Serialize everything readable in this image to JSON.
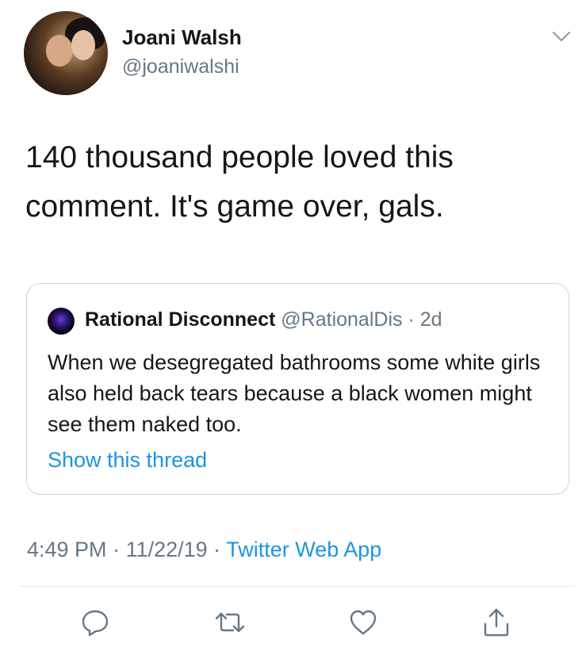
{
  "author": {
    "display_name": "Joani Walsh",
    "handle": "@joaniwalshi"
  },
  "tweet": {
    "text": "140 thousand people loved this comment. It's game over, gals."
  },
  "quoted_tweet": {
    "display_name": "Rational Disconnect",
    "handle": "@RationalDis",
    "age": "· 2d",
    "text": "When we desegregated bathrooms some white girls also held back tears because a black women might see them naked too.",
    "show_thread_label": "Show this thread"
  },
  "meta": {
    "time": "4:49 PM",
    "separator": " · ",
    "date": "11/22/19",
    "app": "Twitter Web App"
  },
  "icons": {
    "menu": "chevron-down-icon",
    "reply": "reply-icon",
    "retweet": "retweet-icon",
    "like": "heart-icon",
    "share": "share-icon"
  },
  "colors": {
    "link": "#1b95e0",
    "secondary_text": "#657786",
    "primary_text": "#14171a",
    "icon": "#657786",
    "border": "#ccd6dd"
  }
}
